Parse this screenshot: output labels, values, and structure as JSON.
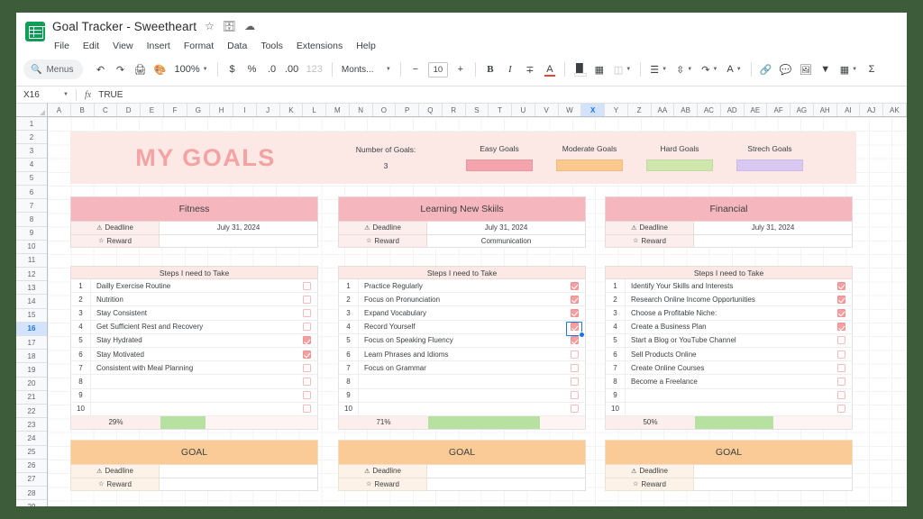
{
  "app": {
    "doc_title": "Goal Tracker - Sweetheart",
    "title_icons": [
      "star-icon",
      "move-to-folder-icon",
      "cloud-saved-icon"
    ],
    "menus": [
      "File",
      "Edit",
      "View",
      "Insert",
      "Format",
      "Data",
      "Tools",
      "Extensions",
      "Help"
    ]
  },
  "toolbar": {
    "search_label": "Menus",
    "zoom": "100%",
    "font": "Monts...",
    "font_size": "10",
    "items": [
      "undo",
      "redo",
      "print",
      "paint-format",
      "currency",
      "percent",
      "decrease-decimal",
      "increase-decimal",
      "number-format",
      "bold",
      "italic",
      "strikethrough",
      "text-color",
      "fill-color",
      "borders",
      "merge-cells",
      "vertical-align",
      "text-wrap",
      "text-rotation",
      "link",
      "comment",
      "image",
      "filter",
      "functions",
      "sigma"
    ]
  },
  "formula_bar": {
    "cell_ref": "X16",
    "fx_label": "fx",
    "value": "TRUE"
  },
  "grid": {
    "columns": [
      "A",
      "B",
      "C",
      "D",
      "E",
      "F",
      "G",
      "H",
      "I",
      "J",
      "K",
      "L",
      "M",
      "N",
      "O",
      "P",
      "Q",
      "R",
      "S",
      "T",
      "U",
      "V",
      "W",
      "X",
      "Y",
      "Z",
      "AA",
      "AB",
      "AC",
      "AD",
      "AE",
      "AF",
      "AG",
      "AH",
      "AI",
      "AJ",
      "AK"
    ],
    "selected_column": "X",
    "rows": [
      1,
      2,
      3,
      4,
      5,
      6,
      7,
      8,
      9,
      10,
      11,
      12,
      13,
      14,
      15,
      16,
      17,
      18,
      19,
      20,
      21,
      22,
      23,
      24,
      25,
      26,
      27,
      28,
      29
    ],
    "selected_row": 16
  },
  "banner": {
    "title": "MY GOALS",
    "number_of_goals_label": "Number of Goals:",
    "number_of_goals_value": "3",
    "legend": [
      {
        "label": "Easy Goals",
        "color": "#f5a3ad"
      },
      {
        "label": "Moderate Goals",
        "color": "#fbc88d"
      },
      {
        "label": "Hard Goals",
        "color": "#cfe6ac"
      },
      {
        "label": "Strech Goals",
        "color": "#d9c8f2"
      }
    ],
    "background": "#fce9e6"
  },
  "labels": {
    "deadline": "Deadline",
    "reward": "Reward",
    "steps_header": "Steps I need to Take",
    "deadline_icon": "warning-triangle-icon",
    "reward_icon": "star-icon"
  },
  "cards": [
    {
      "title": "Fitness",
      "header_color": "#f6b6bd",
      "deadline": "July 31, 2024",
      "reward": "",
      "progress": "29%",
      "progress_fill_pct": 29,
      "steps": [
        {
          "n": "1",
          "text": "Dailly Exercise Routine",
          "checked": false
        },
        {
          "n": "2",
          "text": "Nutrition",
          "checked": false
        },
        {
          "n": "3",
          "text": "Stay Consistent",
          "checked": false
        },
        {
          "n": "4",
          "text": "Get Sufficient Rest and Recovery",
          "checked": false
        },
        {
          "n": "5",
          "text": "Stay Hydrated",
          "checked": true
        },
        {
          "n": "6",
          "text": "Stay Motivated",
          "checked": true
        },
        {
          "n": "7",
          "text": "Consistent with Meal Planning",
          "checked": false
        },
        {
          "n": "8",
          "text": "",
          "checked": false
        },
        {
          "n": "9",
          "text": "",
          "checked": false
        },
        {
          "n": "10",
          "text": "",
          "checked": false
        }
      ]
    },
    {
      "title": "Learning New Skiils",
      "header_color": "#f6b6bd",
      "deadline": "July 31, 2024",
      "reward": "Communication",
      "progress": "71%",
      "progress_fill_pct": 71,
      "selected_step_index": 3,
      "steps": [
        {
          "n": "1",
          "text": "Practice Regularly",
          "checked": true
        },
        {
          "n": "2",
          "text": "Focus on Pronunciation",
          "checked": true
        },
        {
          "n": "3",
          "text": "Expand Vocabulary",
          "checked": true
        },
        {
          "n": "4",
          "text": "Record Yourself",
          "checked": true
        },
        {
          "n": "5",
          "text": "Focus on Speaking Fluency",
          "checked": true
        },
        {
          "n": "6",
          "text": "Learn Phrases and Idioms",
          "checked": false
        },
        {
          "n": "7",
          "text": "Focus on Grammar",
          "checked": false
        },
        {
          "n": "8",
          "text": "",
          "checked": false
        },
        {
          "n": "9",
          "text": "",
          "checked": false
        },
        {
          "n": "10",
          "text": "",
          "checked": false
        }
      ]
    },
    {
      "title": "Financial",
      "header_color": "#f6b6bd",
      "deadline": "July 31, 2024",
      "reward": "",
      "progress": "50%",
      "progress_fill_pct": 50,
      "steps": [
        {
          "n": "1",
          "text": "Identify Your Skills and Interests",
          "checked": true
        },
        {
          "n": "2",
          "text": "Research Online Income Opportunities",
          "checked": true
        },
        {
          "n": "3",
          "text": "Choose a Profitable Niche:",
          "checked": true
        },
        {
          "n": "4",
          "text": "Create a Business Plan",
          "checked": true
        },
        {
          "n": "5",
          "text": "Start a Blog or YouTube Channel",
          "checked": false
        },
        {
          "n": "6",
          "text": "Sell Products Online",
          "checked": false
        },
        {
          "n": "7",
          "text": "Create Online Courses",
          "checked": false
        },
        {
          "n": "8",
          "text": "Become a Freelance",
          "checked": false
        },
        {
          "n": "9",
          "text": "",
          "checked": false
        },
        {
          "n": "10",
          "text": "",
          "checked": false
        }
      ]
    }
  ],
  "cards_bottom": [
    {
      "title": "GOAL",
      "header_color": "#fbcb97",
      "deadline": "",
      "reward": ""
    },
    {
      "title": "GOAL",
      "header_color": "#fbcb97",
      "deadline": "",
      "reward": ""
    },
    {
      "title": "GOAL",
      "header_color": "#fbcb97",
      "deadline": "",
      "reward": ""
    }
  ]
}
